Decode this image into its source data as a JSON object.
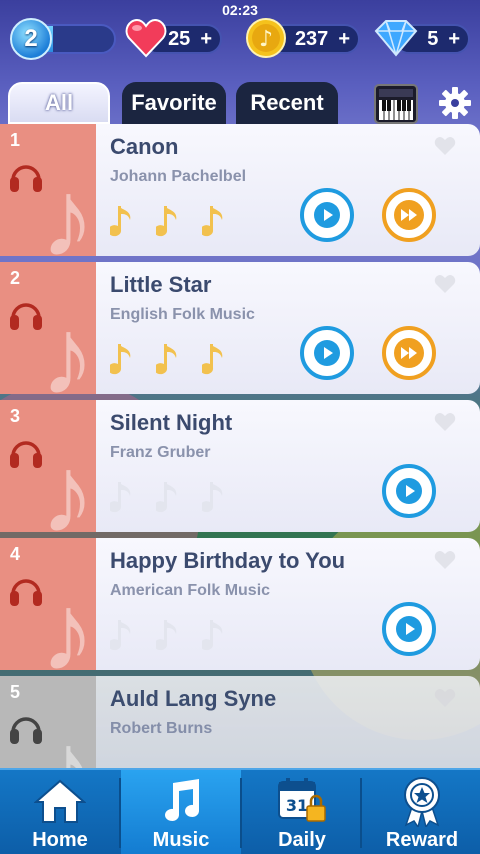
{
  "status_bar": {
    "time": "02:23"
  },
  "header": {
    "level": "2",
    "level_progress": 0.25,
    "lives": "25",
    "coins": "237",
    "gems": "5",
    "plus": "+"
  },
  "tabs": [
    {
      "label": "All",
      "active": true
    },
    {
      "label": "Favorite",
      "active": false
    },
    {
      "label": "Recent",
      "active": false
    }
  ],
  "songs": [
    {
      "rank": "1",
      "title": "Canon",
      "artist": "Johann Pachelbel",
      "stars_earned": 3,
      "stars_total": 3,
      "locked": false,
      "has_fast_forward": true
    },
    {
      "rank": "2",
      "title": "Little Star",
      "artist": "English Folk Music",
      "stars_earned": 3,
      "stars_total": 3,
      "locked": false,
      "has_fast_forward": true
    },
    {
      "rank": "3",
      "title": "Silent Night",
      "artist": "Franz Gruber",
      "stars_earned": 0,
      "stars_total": 3,
      "locked": false,
      "has_fast_forward": false
    },
    {
      "rank": "4",
      "title": "Happy Birthday to You",
      "artist": "American Folk Music",
      "stars_earned": 0,
      "stars_total": 3,
      "locked": false,
      "has_fast_forward": false
    },
    {
      "rank": "5",
      "title": "Auld Lang Syne",
      "artist": "Robert Burns",
      "stars_earned": 0,
      "stars_total": 3,
      "locked": true,
      "has_fast_forward": false
    }
  ],
  "bottom_nav": [
    {
      "label": "Home",
      "icon": "home-icon",
      "active": false
    },
    {
      "label": "Music",
      "icon": "music-note-icon",
      "active": true
    },
    {
      "label": "Daily",
      "icon": "calendar-icon",
      "calendar_day": "31",
      "active": false
    },
    {
      "label": "Reward",
      "icon": "reward-medal-icon",
      "active": false
    }
  ],
  "colors": {
    "accent_blue": "#1f9be0",
    "accent_orange": "#f0a020",
    "rank_red": "#e98f82",
    "note_gold": "#f2c14e"
  }
}
